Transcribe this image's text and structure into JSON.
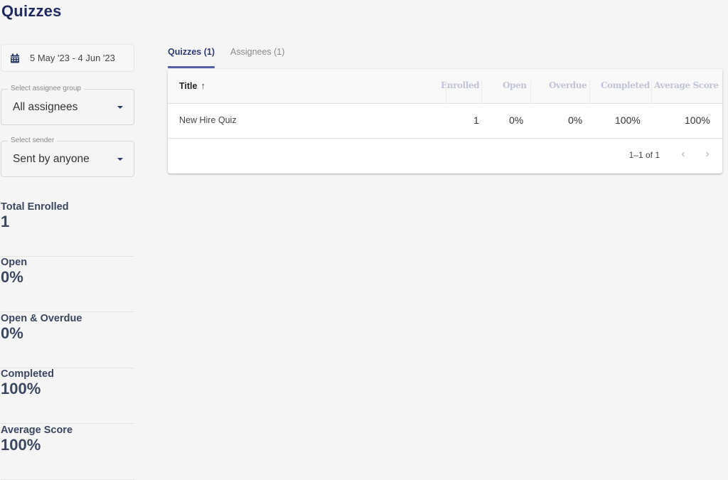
{
  "page": {
    "title": "Quizzes"
  },
  "sidebar": {
    "date_range": "5 May '23 - 4 Jun '23",
    "assignee_group": {
      "label": "Select assignee group",
      "value": "All assignees"
    },
    "sender": {
      "label": "Select sender",
      "value": "Sent by anyone"
    },
    "stats": [
      {
        "label": "Total Enrolled",
        "value": "1"
      },
      {
        "label": "Open",
        "value": "0%"
      },
      {
        "label": "Open & Overdue",
        "value": "0%"
      },
      {
        "label": "Completed",
        "value": "100%"
      },
      {
        "label": "Average Score",
        "value": "100%"
      }
    ]
  },
  "tabs": [
    {
      "label": "Quizzes (1)",
      "active": true
    },
    {
      "label": "Assignees (1)",
      "active": false
    }
  ],
  "table": {
    "columns": {
      "title": "Title",
      "title_sort": "↑",
      "enrolled": "Enrolled",
      "open": "Open",
      "overdue": "Overdue",
      "completed": "Completed",
      "average_score": "Average Score"
    },
    "rows": [
      {
        "title": "New Hire Quiz",
        "enrolled": "1",
        "open": "0%",
        "overdue": "0%",
        "completed": "100%",
        "average_score": "100%"
      }
    ],
    "pagination": {
      "range": "1–1 of 1",
      "prev": "‹",
      "next": "›"
    }
  },
  "colors": {
    "accent": "#565fa5",
    "title": "#1e2a5e",
    "stat_text": "#3b4660"
  }
}
